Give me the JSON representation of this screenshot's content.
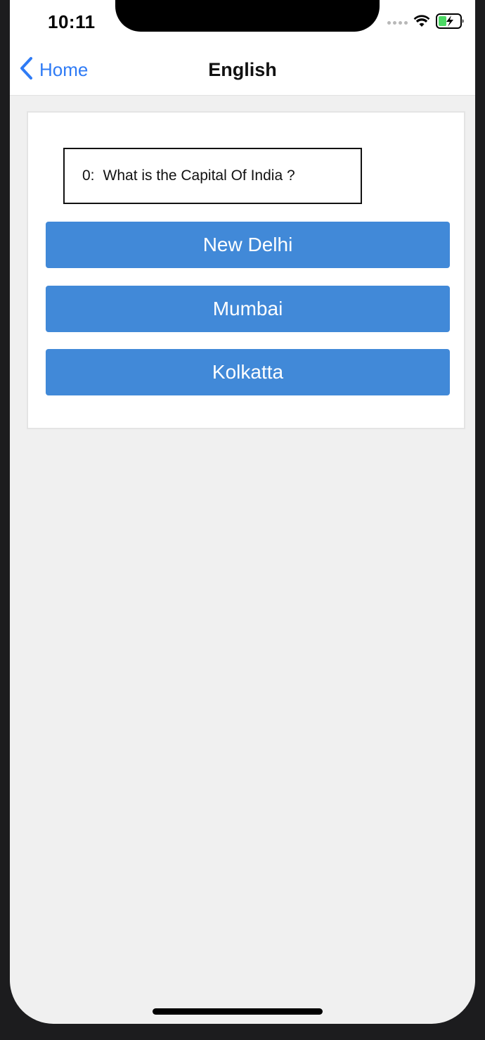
{
  "status_bar": {
    "time": "10:11",
    "icons": [
      "signal-dots-icon",
      "wifi-icon",
      "battery-charging-icon"
    ],
    "battery_color": "#4cd964"
  },
  "nav": {
    "back_label": "Home",
    "back_icon": "chevron-left-icon",
    "title": "English"
  },
  "question": {
    "number": "0:",
    "text": "What is the Capital Of India ?"
  },
  "answers": [
    {
      "label": "New Delhi"
    },
    {
      "label": "Mumbai"
    },
    {
      "label": "Kolkatta"
    }
  ],
  "colors": {
    "accent": "#2f7bf5",
    "button": "#4189d8",
    "background": "#f0f0f0"
  }
}
